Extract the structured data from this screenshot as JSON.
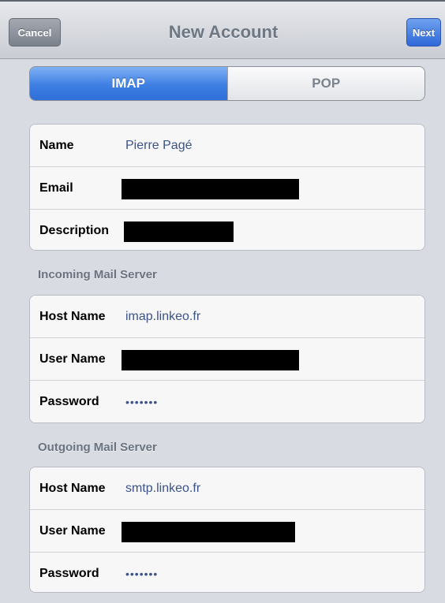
{
  "navbar": {
    "title": "New Account",
    "cancel_label": "Cancel",
    "next_label": "Next"
  },
  "segmented": {
    "options": [
      "IMAP",
      "POP"
    ],
    "selected": "IMAP"
  },
  "account": {
    "name_label": "Name",
    "name_value": "Pierre Pagé",
    "email_label": "Email",
    "description_label": "Description"
  },
  "incoming": {
    "header": "Incoming Mail Server",
    "host_label": "Host Name",
    "host_value": "imap.linkeo.fr",
    "user_label": "User Name",
    "password_label": "Password",
    "password_value": "•••••••"
  },
  "outgoing": {
    "header": "Outgoing Mail Server",
    "host_label": "Host Name",
    "host_value": "smtp.linkeo.fr",
    "user_label": "User Name",
    "password_label": "Password",
    "password_value": "•••••••"
  },
  "colors": {
    "accent_blue": "#3e7fe3",
    "value_text": "#3c5388",
    "background": "#d8dbe1"
  }
}
